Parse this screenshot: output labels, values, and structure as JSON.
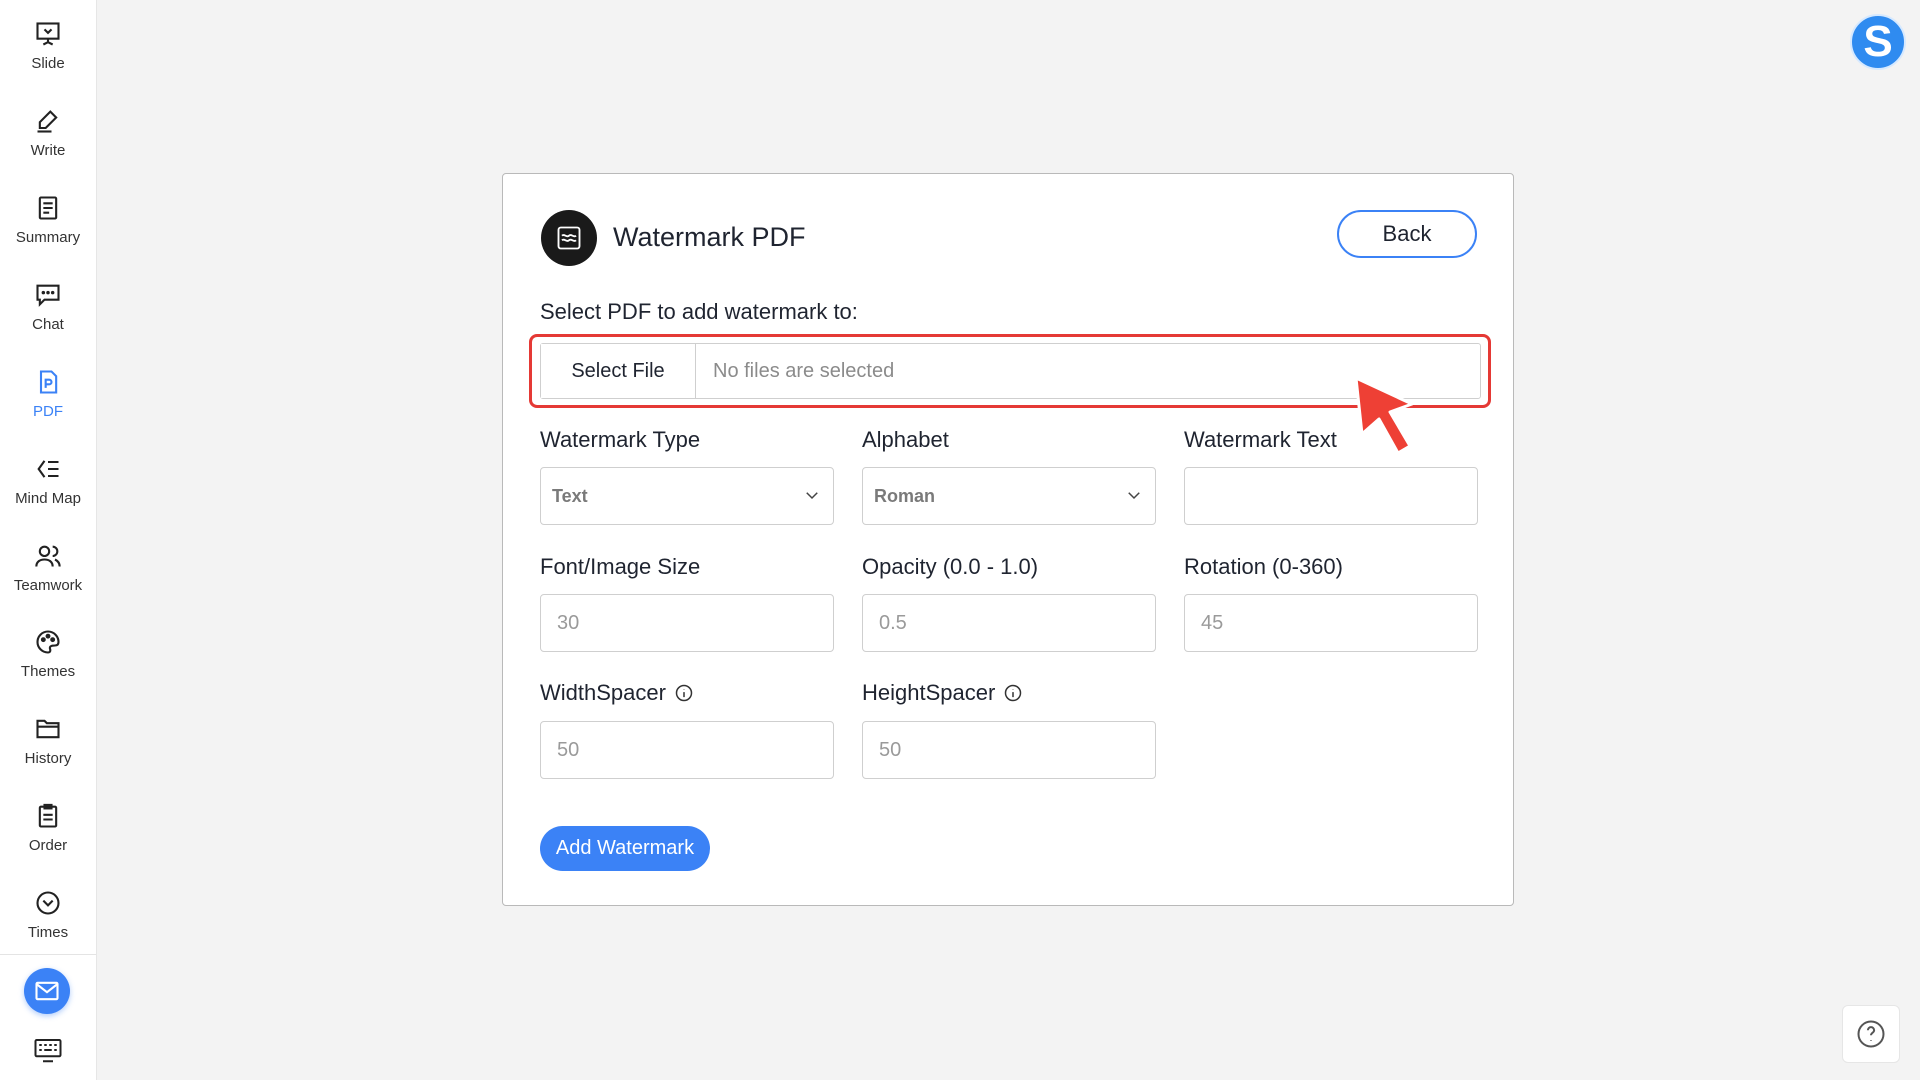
{
  "sidebar": {
    "items": [
      {
        "label": "Slide",
        "icon": "presentation-icon"
      },
      {
        "label": "Write",
        "icon": "pen-icon"
      },
      {
        "label": "Summary",
        "icon": "document-icon"
      },
      {
        "label": "Chat",
        "icon": "chat-icon"
      },
      {
        "label": "PDF",
        "icon": "pdf-icon",
        "active": true
      },
      {
        "label": "Mind Map",
        "icon": "mindmap-icon"
      },
      {
        "label": "Teamwork",
        "icon": "team-icon"
      },
      {
        "label": "Themes",
        "icon": "palette-icon"
      },
      {
        "label": "History",
        "icon": "folder-icon"
      },
      {
        "label": "Order",
        "icon": "clipboard-icon"
      },
      {
        "label": "Times",
        "icon": "chevron-circle-icon"
      }
    ],
    "mail_icon": "mail-icon",
    "keyboard_icon": "keyboard-icon"
  },
  "avatar": {
    "letter": "S",
    "color": "#2f8bf0"
  },
  "card": {
    "title": "Watermark PDF",
    "back_label": "Back",
    "select_label": "Select PDF to add watermark to:",
    "file_button": "Select File",
    "file_status": "No files are selected",
    "fields": {
      "watermark_type": {
        "label": "Watermark Type",
        "value": "Text"
      },
      "alphabet": {
        "label": "Alphabet",
        "value": "Roman"
      },
      "watermark_text": {
        "label": "Watermark Text",
        "value": ""
      },
      "font_size": {
        "label": "Font/Image Size",
        "placeholder": "30"
      },
      "opacity": {
        "label": "Opacity (0.0 - 1.0)",
        "placeholder": "0.5"
      },
      "rotation": {
        "label": "Rotation (0-360)",
        "placeholder": "45"
      },
      "width_spacer": {
        "label": "WidthSpacer",
        "placeholder": "50"
      },
      "height_spacer": {
        "label": "HeightSpacer",
        "placeholder": "50"
      }
    },
    "submit_label": "Add Watermark"
  },
  "colors": {
    "accent": "#3b82f6",
    "highlight": "#e53935",
    "cursor": "#ee4035"
  }
}
